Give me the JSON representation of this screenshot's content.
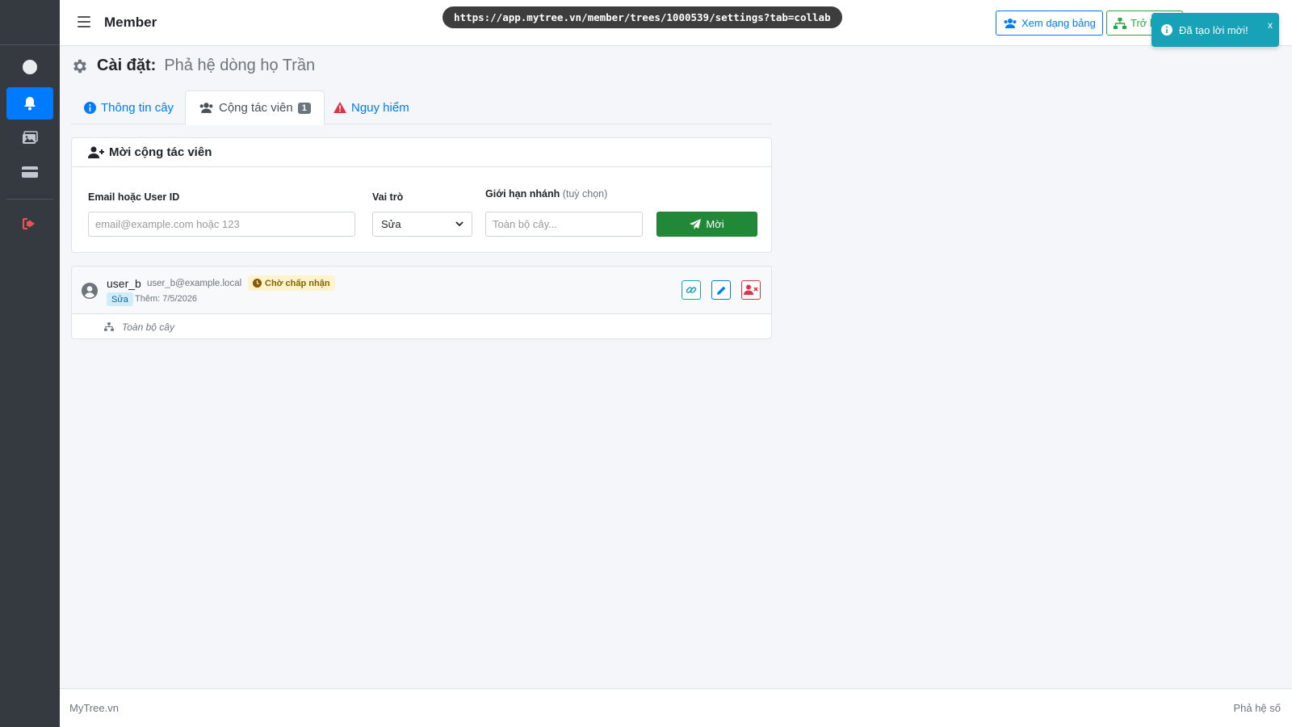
{
  "app": {
    "title": "Member",
    "url": "https://app.mytree.vn/member/trees/1000539/settings?tab=collab"
  },
  "header": {
    "table_view_label": "Xem dạng bảng",
    "back_label": "Trở lại"
  },
  "toast": {
    "message": "Đã tạo lời mời!",
    "close": "x"
  },
  "page": {
    "title_label": "Cài đặt:",
    "tree_name": "Phả hệ dòng họ Trần"
  },
  "tabs": [
    {
      "label": "Thông tin cây",
      "icon": "info-circle-icon"
    },
    {
      "label": "Cộng tác viên",
      "icon": "users-icon",
      "badge": "1"
    },
    {
      "label": "Nguy hiểm",
      "icon": "warning-triangle-icon"
    }
  ],
  "invite": {
    "header": "Mời cộng tác viên",
    "email_label": "Email hoặc User ID",
    "email_placeholder": "email@example.com hoặc 123",
    "role_label": "Vai trò",
    "role_value": "Sửa",
    "limit_label": "Giới hạn nhánh",
    "limit_optional": "(tuỳ chọn)",
    "limit_placeholder": "Toàn bộ cây...",
    "submit_label": "Mời"
  },
  "collaborators": [
    {
      "username": "user_b",
      "email": "user_b@example.local",
      "status": "Chờ chấp nhận",
      "role": "Sửa",
      "added": "Thêm: 7/5/2026",
      "scope": "Toàn bộ cây"
    }
  ],
  "footer": {
    "left": "MyTree.vn",
    "right": "Phả hệ số"
  },
  "colors": {
    "primary": "#007bff",
    "success": "#218838",
    "info": "#17a2b8",
    "danger": "#dc3545",
    "sidebar": "#343a40"
  }
}
